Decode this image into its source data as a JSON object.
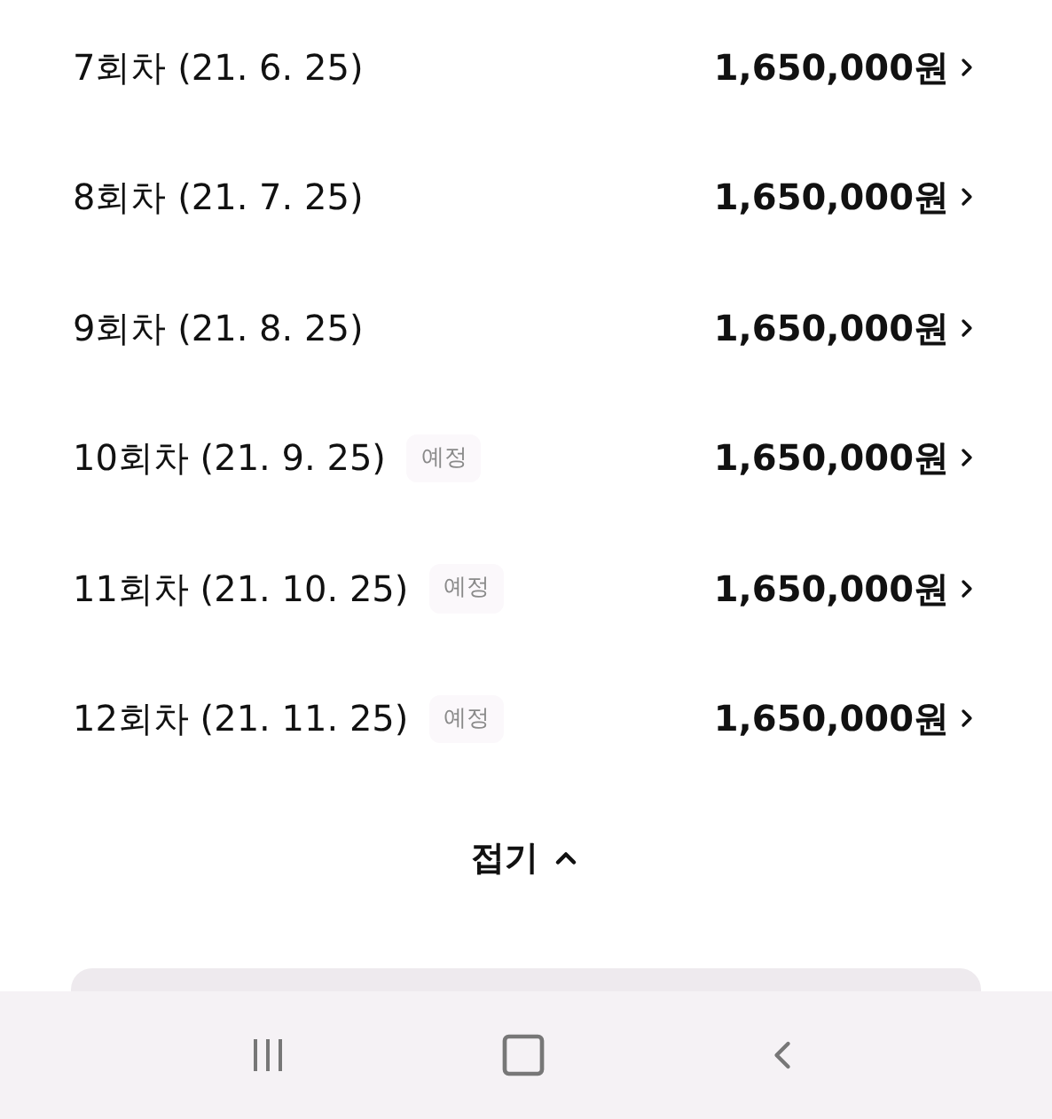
{
  "installments": [
    {
      "label": "7회차 (21. 6. 25)",
      "amount": "1,650,000원"
    },
    {
      "label": "8회차 (21. 7. 25)",
      "amount": "1,650,000원"
    },
    {
      "label": "9회차 (21. 8. 25)",
      "amount": "1,650,000원"
    },
    {
      "label": "10회차 (21. 9. 25)",
      "status": "예정",
      "amount": "1,650,000원"
    },
    {
      "label": "11회차 (21. 10. 25)",
      "status": "예정",
      "amount": "1,650,000원"
    },
    {
      "label": "12회차 (21. 11. 25)",
      "status": "예정",
      "amount": "1,650,000원"
    }
  ],
  "collapse_button": {
    "label": "접기"
  }
}
